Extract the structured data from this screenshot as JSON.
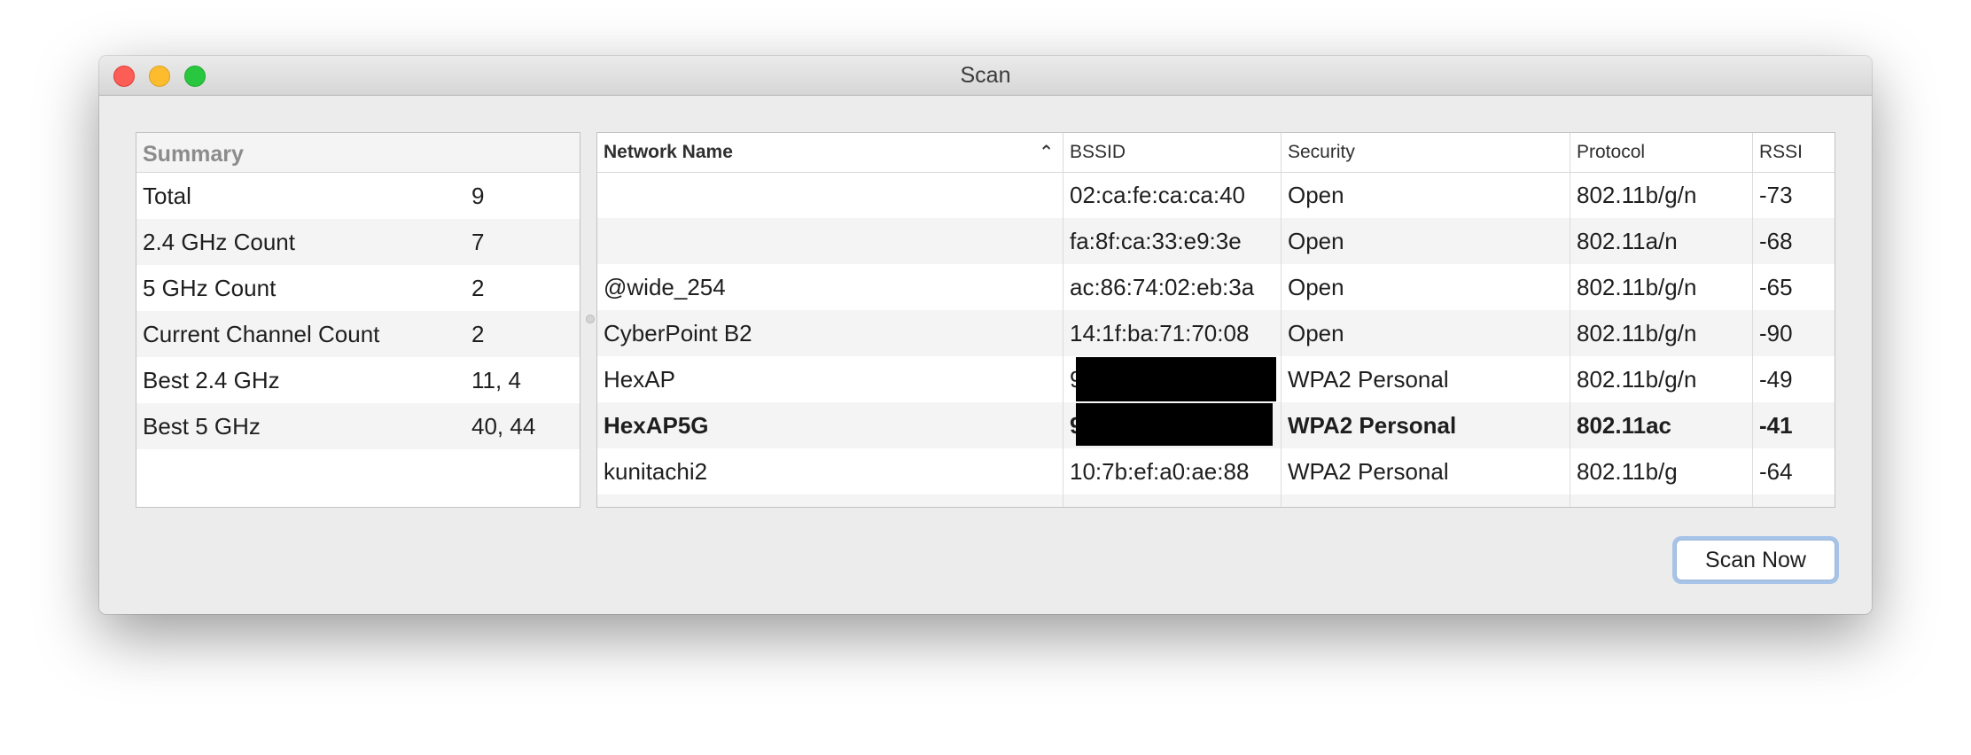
{
  "window": {
    "title": "Scan"
  },
  "summary": {
    "header": "Summary",
    "rows": [
      {
        "label": "Total",
        "value": "9"
      },
      {
        "label": "2.4 GHz Count",
        "value": "7"
      },
      {
        "label": "5 GHz Count",
        "value": "2"
      },
      {
        "label": "Current Channel Count",
        "value": "2"
      },
      {
        "label": "Best 2.4 GHz",
        "value": "11, 4"
      },
      {
        "label": "Best 5 GHz",
        "value": "40, 44"
      }
    ]
  },
  "table": {
    "columns": {
      "name": "Network Name",
      "bssid": "BSSID",
      "security": "Security",
      "protocol": "Protocol",
      "rssi": "RSSI"
    },
    "sort_icon": "chevron-up-icon",
    "rows": [
      {
        "name": "",
        "bssid": "02:ca:fe:ca:ca:40",
        "security": "Open",
        "protocol": "802.11b/g/n",
        "rssi": "-73"
      },
      {
        "name": "",
        "bssid": "fa:8f:ca:33:e9:3e",
        "security": "Open",
        "protocol": "802.11a/n",
        "rssi": "-68"
      },
      {
        "name": "@wide_254",
        "bssid": "ac:86:74:02:eb:3a",
        "security": "Open",
        "protocol": "802.11b/g/n",
        "rssi": "-65"
      },
      {
        "name": "CyberPoint B2",
        "bssid": "14:1f:ba:71:70:08",
        "security": "Open",
        "protocol": "802.11b/g/n",
        "rssi": "-90"
      },
      {
        "name": "HexAP",
        "bssid": "9",
        "security": "WPA2 Personal",
        "protocol": "802.11b/g/n",
        "rssi": "-49"
      },
      {
        "name": "HexAP5G",
        "bssid": "9",
        "security": "WPA2 Personal",
        "protocol": "802.11ac",
        "rssi": "-41"
      },
      {
        "name": "kunitachi2",
        "bssid": "10:7b:ef:a0:ae:88",
        "security": "WPA2 Personal",
        "protocol": "802.11b/g",
        "rssi": "-64"
      }
    ]
  },
  "actions": {
    "scan_now": "Scan Now"
  },
  "colors": {
    "close": "#fc5d56",
    "minimize": "#fdbc2e",
    "maximize": "#29c740",
    "focus_ring": "#6fa3e6"
  }
}
